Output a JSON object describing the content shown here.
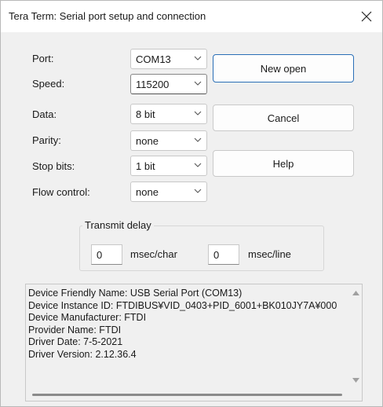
{
  "window": {
    "title": "Tera Term: Serial port setup and connection"
  },
  "fields": [
    {
      "label": "Port:",
      "value": "COM13"
    },
    {
      "label": "Speed:",
      "value": "115200"
    },
    {
      "label": "Data:",
      "value": "8 bit"
    },
    {
      "label": "Parity:",
      "value": "none"
    },
    {
      "label": "Stop bits:",
      "value": "1 bit"
    },
    {
      "label": "Flow control:",
      "value": "none"
    }
  ],
  "buttons": {
    "new_open": "New open",
    "cancel": "Cancel",
    "help": "Help"
  },
  "transmit_delay": {
    "legend": "Transmit delay",
    "char_value": "0",
    "char_unit": "msec/char",
    "line_value": "0",
    "line_unit": "msec/line"
  },
  "device_info": [
    "Device Friendly Name: USB Serial Port (COM13)",
    "Device Instance ID: FTDIBUS¥VID_0403+PID_6001+BK010JY7A¥000",
    "Device Manufacturer: FTDI",
    "Provider Name: FTDI",
    "Driver Date: 7-5-2021",
    "Driver Version: 2.12.36.4"
  ]
}
